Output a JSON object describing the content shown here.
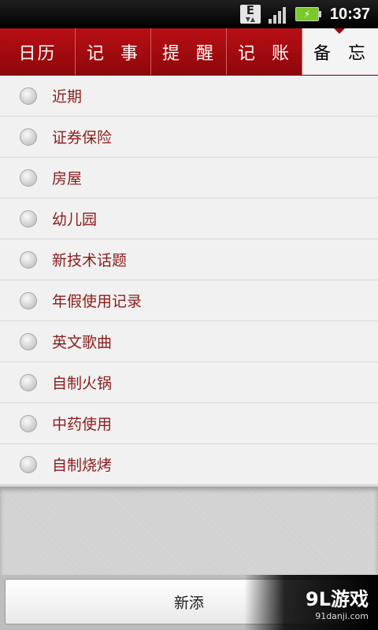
{
  "status_bar": {
    "network_label": "E",
    "time": "10:37",
    "battery_symbol": "⚡"
  },
  "tabs": [
    {
      "label": [
        "日历"
      ],
      "active": false
    },
    {
      "label": [
        "记",
        "事"
      ],
      "active": false
    },
    {
      "label": [
        "提",
        "醒"
      ],
      "active": false
    },
    {
      "label": [
        "记",
        "账"
      ],
      "active": false
    },
    {
      "label": [
        "备",
        "忘"
      ],
      "active": true
    }
  ],
  "memo_list": [
    "近期",
    "证券保险",
    "房屋",
    "幼儿园",
    "新技术话题",
    "年假使用记录",
    "英文歌曲",
    "自制火锅",
    "中药使用",
    "自制烧烤"
  ],
  "bottom": {
    "add_label": "新添"
  },
  "watermark": {
    "main": "9L游戏",
    "sub": "91danji.com"
  },
  "colors": {
    "accent": "#a80b10",
    "item_text": "#8c1c1c"
  }
}
